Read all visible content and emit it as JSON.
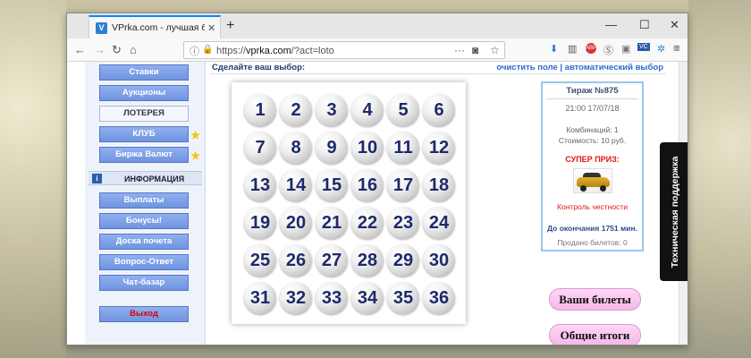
{
  "browser": {
    "tab_title": "VPrka.com - лучшая биржа ст",
    "favicon_letter": "V",
    "url_prefix": "https://",
    "url_domain": "vprka.com",
    "url_path": "/?act=loto"
  },
  "sidebar": {
    "items": [
      {
        "label": "Ставки"
      },
      {
        "label": "Аукционы"
      },
      {
        "label": "ЛОТЕРЕЯ"
      },
      {
        "label": "КЛУБ"
      },
      {
        "label": "Биржа Валют"
      }
    ],
    "info_header": "ИНФОРМАЦИЯ",
    "info_items": [
      {
        "label": "Выплаты"
      },
      {
        "label": "Бонусы!"
      },
      {
        "label": "Доска почета"
      },
      {
        "label": "Вопрос-Ответ"
      },
      {
        "label": "Чат-базар"
      }
    ],
    "exit_label": "Выход"
  },
  "main": {
    "pick_title": "Сделайте ваш выбор:",
    "clear_link": "очистить поле",
    "separator": "|",
    "auto_link": "автоматический выбор",
    "numbers": [
      "1",
      "2",
      "3",
      "4",
      "5",
      "6",
      "7",
      "8",
      "9",
      "10",
      "11",
      "12",
      "13",
      "14",
      "15",
      "16",
      "17",
      "18",
      "19",
      "20",
      "21",
      "22",
      "23",
      "24",
      "25",
      "26",
      "27",
      "28",
      "29",
      "30",
      "31",
      "32",
      "33",
      "34",
      "35",
      "36"
    ]
  },
  "draw": {
    "title": "Тираж №875",
    "time": "21:00 17/07/18",
    "combinations": "Комбинаций: 1",
    "cost": "Стоимость: 10 руб.",
    "super_prize": "СУПЕР ПРИЗ:",
    "honesty": "Контроль честности",
    "remaining": "До окончания 1751 мин.",
    "sold": "Продано билетов: 0"
  },
  "buttons": {
    "your_tickets": "Ваши билеты",
    "totals": "Общие итоги"
  },
  "support_label": "Техническая поддержка"
}
